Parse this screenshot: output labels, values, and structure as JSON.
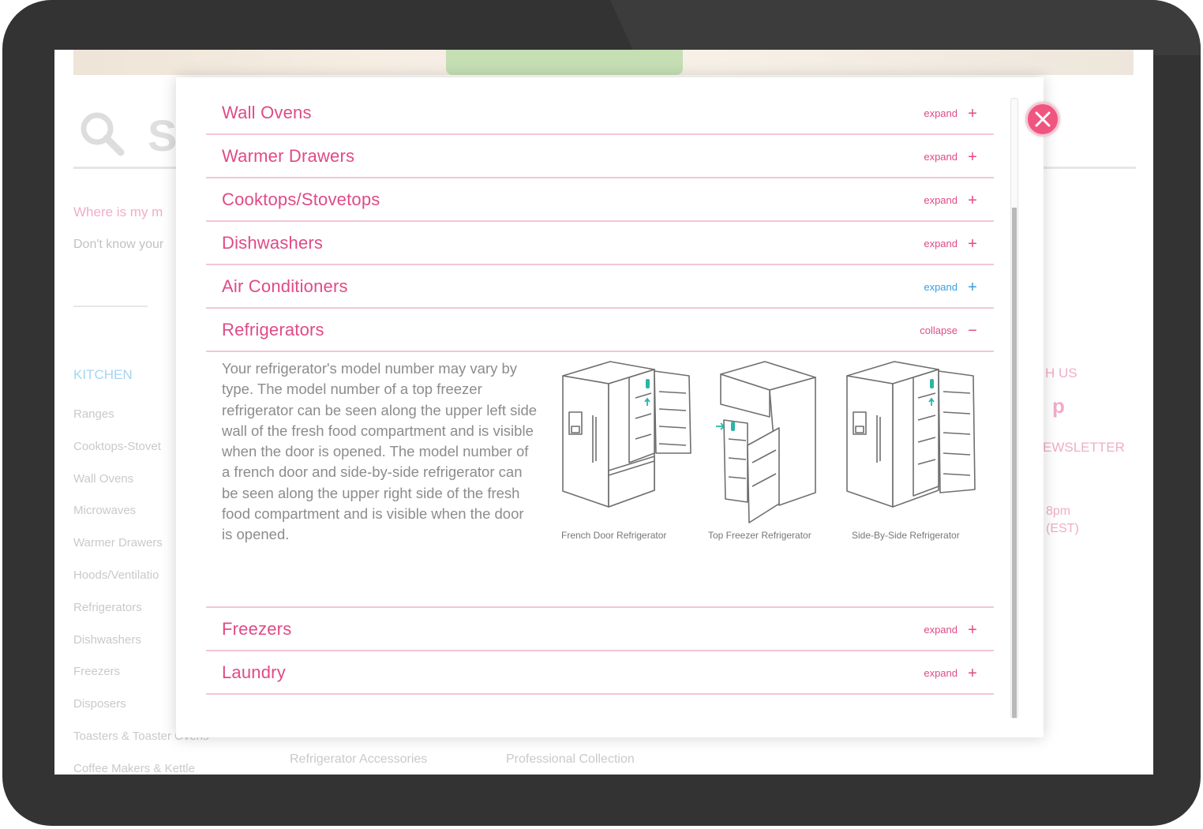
{
  "background": {
    "search_letter": "S",
    "where_link": "Where is my m",
    "dont_know": "Don't know your",
    "section_kitchen": "KITCHEN",
    "kitchen_items": [
      "Ranges",
      "Cooktops-Stovet",
      "Wall Ovens",
      "Microwaves",
      "Warmer Drawers",
      "Hoods/Ventilatio",
      "Refrigerators",
      "Dishwashers",
      "Freezers",
      "Disposers",
      "Toasters & Toaster Ovens",
      "Coffee Makers & Kettle"
    ],
    "right_contact": "H US",
    "right_pinterest": "p",
    "right_newsletter": "EWSLETTER",
    "right_hours_1": "8pm",
    "right_hours_2": "(EST)",
    "bottom_col2": "Refrigerator Accessories",
    "bottom_col3": "Professional Collection"
  },
  "modal": {
    "close_label": "×",
    "accordion": [
      {
        "title": "Wall Ovens",
        "toggle": "expand",
        "sign": "+"
      },
      {
        "title": "Warmer Drawers",
        "toggle": "expand",
        "sign": "+"
      },
      {
        "title": "Cooktops/Stovetops",
        "toggle": "expand",
        "sign": "+"
      },
      {
        "title": "Dishwashers",
        "toggle": "expand",
        "sign": "+"
      },
      {
        "title": "Air Conditioners",
        "toggle": "expand",
        "sign": "+",
        "hover": true
      },
      {
        "title": "Refrigerators",
        "toggle": "collapse",
        "sign": "−",
        "open": true
      },
      {
        "title": "Freezers",
        "toggle": "expand",
        "sign": "+"
      },
      {
        "title": "Laundry",
        "toggle": "expand",
        "sign": "+"
      }
    ],
    "refrigerators_panel": {
      "description": "Your refrigerator's model number may vary by type. The model number of a top freezer refrigerator can be seen along the upper left side wall of the fresh food compartment and is visible when the door is opened. The model number of a french door and side-by-side refrigerator can be seen along the upper right side of the fresh food compartment and is visible when the door is opened.",
      "diagrams": [
        {
          "caption": "French Door Refrigerator",
          "icon": "french-door-fridge-icon"
        },
        {
          "caption": "Top Freezer Refrigerator",
          "icon": "top-freezer-fridge-icon"
        },
        {
          "caption": "Side-By-Side Refrigerator",
          "icon": "side-by-side-fridge-icon"
        }
      ]
    }
  },
  "colors": {
    "pink": "#e04a86",
    "blue": "#3a9fe0",
    "close": "#f0557f",
    "teal": "#2bb5a6"
  }
}
